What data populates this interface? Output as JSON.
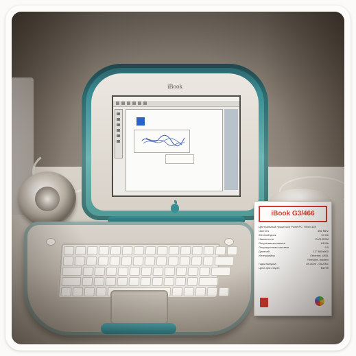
{
  "laptop": {
    "brand_label": "iBook",
    "lid_color": "#3a8d93"
  },
  "info_card": {
    "title": "iBook G3/466",
    "title_color": "#d43a2e",
    "rows": [
      {
        "label": "Центральный процессор PowerPC 750cx 32K",
        "value": ""
      },
      {
        "label": "Частота",
        "value": "466 MHz"
      },
      {
        "label": "Жесткий диск",
        "value": "10 Gb"
      },
      {
        "label": "Накопитель",
        "value": "DVD-ROM"
      },
      {
        "label": "Оперативная память",
        "value": "64 Mb"
      },
      {
        "label": "Операционная система",
        "value": "9.0"
      },
      {
        "label": "Дисплей",
        "value": "12\" 800x600"
      },
      {
        "label": "Интерфейсы",
        "value": "Ethernet, USB,"
      },
      {
        "label": "",
        "value": "FireWire, modem"
      },
      {
        "label": "Годы выпуска",
        "value": "09.2000 - 05.2001"
      },
      {
        "label": "Цена при старте",
        "value": "$1799"
      }
    ],
    "logo_icon": "rainbow-apple-icon"
  }
}
